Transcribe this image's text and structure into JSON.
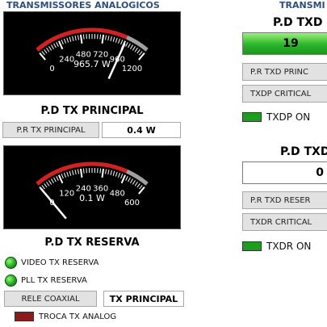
{
  "left_panel": {
    "title": "TRANSMISSORES ANALOGICOS",
    "principal": {
      "gauge_ticks": [
        "0",
        "240",
        "480",
        "720",
        "960",
        "1200"
      ],
      "gauge_readout": "965.7 W",
      "gauge_value": 965.7,
      "gauge_max": 1200,
      "label": "P.D TX PRINCIPAL",
      "pr_label": "P.R TX PRINCIPAL",
      "pr_value": "0.4 W"
    },
    "reserva": {
      "gauge_ticks": [
        "0",
        "120",
        "240",
        "360",
        "480",
        "600"
      ],
      "gauge_readout": "0.1 W",
      "gauge_value": 0.1,
      "gauge_max": 600,
      "label": "P.D TX RESERVA",
      "status": [
        {
          "label": "VIDEO TX RESERVA",
          "color": "#22b022"
        },
        {
          "label": "PLL TX RESERVA",
          "color": "#22b022"
        }
      ],
      "rele_label": "RELE COAXIAL",
      "rele_value": "TX PRINCIPAL",
      "troca_label": "TROCA TX ANALOG",
      "troca_color": "#8b1a1a"
    }
  },
  "right_panel": {
    "title": "TRANSMI",
    "principal": {
      "label": "P.D TXD",
      "value": "19",
      "value_color": "#2ab52a",
      "pr_button": "P.R TXD PRINC",
      "critical_button": "TXDP CRITICAL",
      "on_label": "TXDP ON",
      "on_color": "#1e9e1e"
    },
    "reserva": {
      "label": "P.D TXD",
      "value": "0",
      "pr_button": "P.R TXD RESER",
      "critical_button": "TXDR CRITICAL",
      "on_label": "TXDR ON",
      "on_color": "#1e9e1e"
    }
  }
}
